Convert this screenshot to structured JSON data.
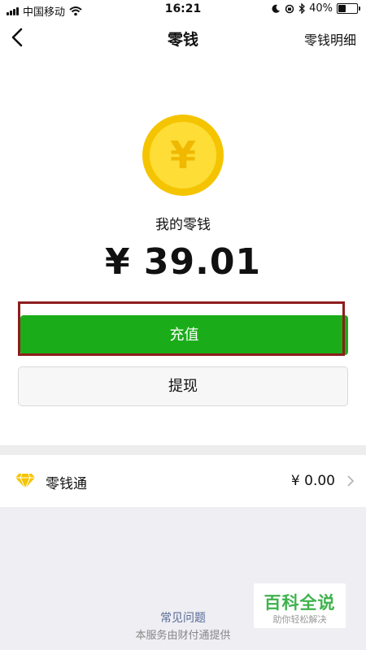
{
  "status_bar": {
    "carrier": "中国移动",
    "time": "16:21",
    "battery": "40%",
    "battery_level": 0.4
  },
  "nav": {
    "title": "零钱",
    "right_link": "零钱明细"
  },
  "wallet": {
    "coin_symbol": "¥",
    "label": "我的零钱",
    "amount": "¥ 39.01"
  },
  "actions": {
    "recharge": "充值",
    "withdraw": "提现"
  },
  "lingqiantong": {
    "label": "零钱通",
    "value": "¥ 0.00"
  },
  "footer": {
    "faq": "常见问题",
    "provider": "本服务由财付通提供"
  },
  "watermark": {
    "title": "百科全说",
    "subtitle": "助你轻松解决"
  },
  "colors": {
    "accent_green": "#1aad19",
    "highlight_border": "#8e1d1d",
    "coin_gold": "#f5c400",
    "link_blue": "#576b95"
  }
}
